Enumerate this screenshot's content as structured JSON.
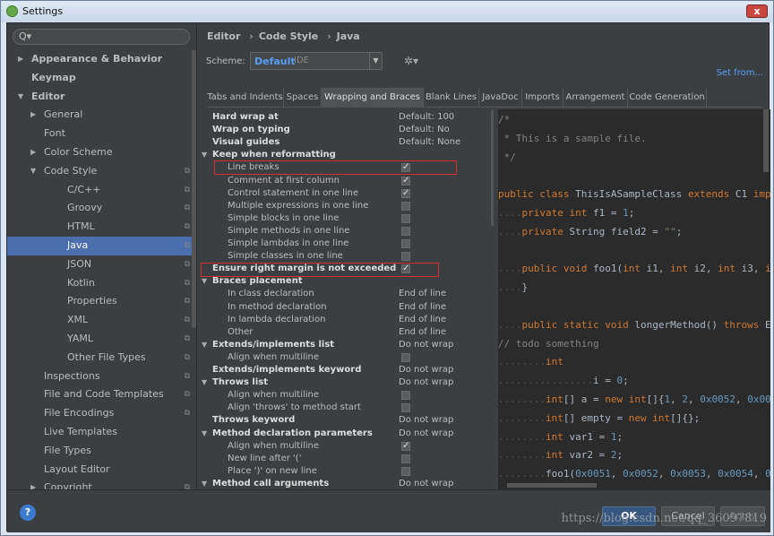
{
  "window": {
    "title": "Settings",
    "close": "x"
  },
  "search": {
    "placeholder": "Q▾"
  },
  "tree": [
    {
      "label": "Appearance & Behavior",
      "level": 0,
      "arrow": "right",
      "bold": true
    },
    {
      "label": "Keymap",
      "level": 0,
      "arrow": "",
      "bold": true
    },
    {
      "label": "Editor",
      "level": 0,
      "arrow": "down",
      "bold": true
    },
    {
      "label": "General",
      "level": 1,
      "arrow": "right"
    },
    {
      "label": "Font",
      "level": 1,
      "arrow": ""
    },
    {
      "label": "Color Scheme",
      "level": 1,
      "arrow": "right"
    },
    {
      "label": "Code Style",
      "level": 1,
      "arrow": "down",
      "copy": true
    },
    {
      "label": "C/C++",
      "level": 2,
      "copy": true
    },
    {
      "label": "Groovy",
      "level": 2,
      "copy": true
    },
    {
      "label": "HTML",
      "level": 2,
      "copy": true
    },
    {
      "label": "Java",
      "level": 2,
      "copy": true,
      "selected": true
    },
    {
      "label": "JSON",
      "level": 2,
      "copy": true
    },
    {
      "label": "Kotlin",
      "level": 2,
      "copy": true
    },
    {
      "label": "Properties",
      "level": 2,
      "copy": true
    },
    {
      "label": "XML",
      "level": 2,
      "copy": true
    },
    {
      "label": "YAML",
      "level": 2,
      "copy": true
    },
    {
      "label": "Other File Types",
      "level": 2,
      "copy": true
    },
    {
      "label": "Inspections",
      "level": 1,
      "copy": true
    },
    {
      "label": "File and Code Templates",
      "level": 1,
      "copy": true
    },
    {
      "label": "File Encodings",
      "level": 1,
      "copy": true
    },
    {
      "label": "Live Templates",
      "level": 1
    },
    {
      "label": "File Types",
      "level": 1
    },
    {
      "label": "Layout Editor",
      "level": 1
    },
    {
      "label": "Copyright",
      "level": 1,
      "arrow": "right",
      "copy": true
    }
  ],
  "breadcrumb": [
    "Editor",
    "Code Style",
    "Java"
  ],
  "breadcrumb_sep": "›",
  "scheme": {
    "label": "Scheme:",
    "value": "Default",
    "suffix": "IDE",
    "set_from": "Set from..."
  },
  "tabs": [
    "Tabs and Indents",
    "Spaces",
    "Wrapping and Braces",
    "Blank Lines",
    "JavaDoc",
    "Imports",
    "Arrangement",
    "Code Generation"
  ],
  "active_tab": 2,
  "options": [
    {
      "label": "Hard wrap at",
      "bold": true,
      "value": "Default: 100"
    },
    {
      "label": "Wrap on typing",
      "bold": true,
      "value": "Default: No"
    },
    {
      "label": "Visual guides",
      "bold": true,
      "value": "Default: None"
    },
    {
      "label": "Keep when reformatting",
      "bold": true,
      "group": true
    },
    {
      "label": "Line breaks",
      "indent": true,
      "check": true
    },
    {
      "label": "Comment at first column",
      "indent": true,
      "check": true
    },
    {
      "label": "Control statement in one line",
      "indent": true,
      "check": true
    },
    {
      "label": "Multiple expressions in one line",
      "indent": true,
      "check": false
    },
    {
      "label": "Simple blocks in one line",
      "indent": true,
      "check": false
    },
    {
      "label": "Simple methods in one line",
      "indent": true,
      "check": false
    },
    {
      "label": "Simple lambdas in one line",
      "indent": true,
      "check": false
    },
    {
      "label": "Simple classes in one line",
      "indent": true,
      "check": false
    },
    {
      "label": "Ensure right margin is not exceeded",
      "bold": true,
      "check": true
    },
    {
      "label": "Braces placement",
      "bold": true,
      "group": true
    },
    {
      "label": "In class declaration",
      "indent": true,
      "value": "End of line"
    },
    {
      "label": "In method declaration",
      "indent": true,
      "value": "End of line"
    },
    {
      "label": "In lambda declaration",
      "indent": true,
      "value": "End of line"
    },
    {
      "label": "Other",
      "indent": true,
      "value": "End of line"
    },
    {
      "label": "Extends/implements list",
      "bold": true,
      "group": true,
      "value": "Do not wrap"
    },
    {
      "label": "Align when multiline",
      "indent": true,
      "check": false
    },
    {
      "label": "Extends/implements keyword",
      "bold": true,
      "value": "Do not wrap"
    },
    {
      "label": "Throws list",
      "bold": true,
      "group": true,
      "value": "Do not wrap"
    },
    {
      "label": "Align when multiline",
      "indent": true,
      "check": false
    },
    {
      "label": "Align 'throws' to method start",
      "indent": true,
      "check": false
    },
    {
      "label": "Throws keyword",
      "bold": true,
      "value": "Do not wrap"
    },
    {
      "label": "Method declaration parameters",
      "bold": true,
      "group": true,
      "value": "Do not wrap"
    },
    {
      "label": "Align when multiline",
      "indent": true,
      "check": true
    },
    {
      "label": "New line after '('",
      "indent": true,
      "check": false
    },
    {
      "label": "Place ')' on new line",
      "indent": true,
      "check": false
    },
    {
      "label": "Method call arguments",
      "bold": true,
      "group": true,
      "value": "Do not wrap"
    }
  ],
  "code_lines": [
    [
      [
        "cm",
        "/*"
      ]
    ],
    [
      [
        "cm",
        " * This is a sample file."
      ]
    ],
    [
      [
        "cm",
        " */"
      ]
    ],
    [],
    [
      [
        "kw",
        "public class "
      ],
      [
        "t",
        "ThisIsASampleClass "
      ],
      [
        "kw",
        "extends "
      ],
      [
        "t",
        "C1 "
      ],
      [
        "kw",
        "imp"
      ]
    ],
    [
      [
        "ws",
        "...."
      ],
      [
        "kw",
        "private int "
      ],
      [
        "t",
        "f1 = "
      ],
      [
        "nm",
        "1"
      ],
      [
        "t",
        ";"
      ]
    ],
    [
      [
        "ws",
        "...."
      ],
      [
        "kw",
        "private "
      ],
      [
        "t",
        "String field2 = "
      ],
      [
        "st",
        "\"\""
      ],
      [
        "t",
        ";"
      ]
    ],
    [],
    [
      [
        "ws",
        "...."
      ],
      [
        "kw",
        "public void "
      ],
      [
        "t",
        "foo1("
      ],
      [
        "kw",
        "int "
      ],
      [
        "t",
        "i1, "
      ],
      [
        "kw",
        "int "
      ],
      [
        "t",
        "i2, "
      ],
      [
        "kw",
        "int "
      ],
      [
        "t",
        "i3, "
      ],
      [
        "kw",
        "i"
      ]
    ],
    [
      [
        "ws",
        "...."
      ],
      [
        "t",
        "}"
      ]
    ],
    [],
    [
      [
        "ws",
        "...."
      ],
      [
        "kw",
        "public static void "
      ],
      [
        "t",
        "longerMethod() "
      ],
      [
        "kw",
        "throws "
      ],
      [
        "t",
        "E"
      ]
    ],
    [
      [
        "cm",
        "// todo something"
      ]
    ],
    [
      [
        "ws",
        "........"
      ],
      [
        "kw",
        "int"
      ]
    ],
    [
      [
        "ws",
        "................"
      ],
      [
        "t",
        "i = "
      ],
      [
        "nm",
        "0"
      ],
      [
        "t",
        ";"
      ]
    ],
    [
      [
        "ws",
        "........"
      ],
      [
        "kw",
        "int"
      ],
      [
        "t",
        "[] a = "
      ],
      [
        "kw",
        "new int"
      ],
      [
        "t",
        "[]{"
      ],
      [
        "nm",
        "1"
      ],
      [
        "t",
        ", "
      ],
      [
        "nm",
        "2"
      ],
      [
        "t",
        ", "
      ],
      [
        "nm",
        "0x0052"
      ],
      [
        "t",
        ", "
      ],
      [
        "nm",
        "0x00"
      ]
    ],
    [
      [
        "ws",
        "........"
      ],
      [
        "kw",
        "int"
      ],
      [
        "t",
        "[] empty = "
      ],
      [
        "kw",
        "new int"
      ],
      [
        "t",
        "[]{};"
      ]
    ],
    [
      [
        "ws",
        "........"
      ],
      [
        "kw",
        "int "
      ],
      [
        "t",
        "var1 = "
      ],
      [
        "nm",
        "1"
      ],
      [
        "t",
        ";"
      ]
    ],
    [
      [
        "ws",
        "........"
      ],
      [
        "kw",
        "int "
      ],
      [
        "t",
        "var2 = "
      ],
      [
        "nm",
        "2"
      ],
      [
        "t",
        ";"
      ]
    ],
    [
      [
        "ws",
        "........"
      ],
      [
        "t",
        "foo1("
      ],
      [
        "nm",
        "0x0051"
      ],
      [
        "t",
        ", "
      ],
      [
        "nm",
        "0x0052"
      ],
      [
        "t",
        ", "
      ],
      [
        "nm",
        "0x0053"
      ],
      [
        "t",
        ", "
      ],
      [
        "nm",
        "0x0054"
      ],
      [
        "t",
        ", "
      ],
      [
        "nm",
        "0"
      ]
    ]
  ],
  "footer": {
    "help": "?",
    "ok": "OK",
    "cancel": "Cancel",
    "apply": "Apply"
  },
  "watermark": "https://blog.csdn.net/qq_36097819"
}
